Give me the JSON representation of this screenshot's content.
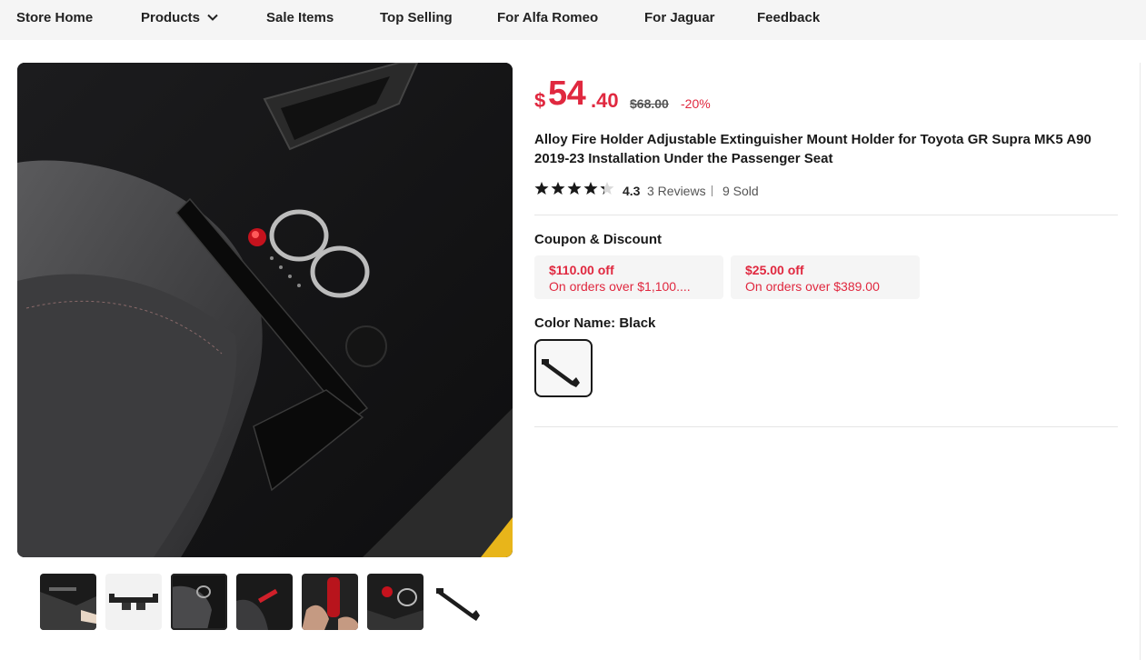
{
  "nav": {
    "items": [
      "Store Home",
      "Products",
      "Sale Items",
      "Top Selling",
      "For Alfa Romeo",
      "For Jaguar",
      "Feedback"
    ]
  },
  "product": {
    "price": {
      "currency": "$",
      "integer": "54",
      "decimal": ".40",
      "original": "$68.00",
      "discount": "-20%"
    },
    "title": "Alloy Fire Holder Adjustable Extinguisher Mount Holder for Toyota GR Supra MK5 A90 2019-23 Installation Under the Passenger Seat",
    "rating": {
      "stars_value": 4.3,
      "value": "4.3",
      "reviews": "3 Reviews",
      "sold": "9 Sold"
    },
    "coupons": {
      "label": "Coupon & Discount",
      "items": [
        {
          "amount": "$110.00 off",
          "condition": "On orders over $1,100...."
        },
        {
          "amount": "$25.00 off",
          "condition": "On orders over $389.00"
        }
      ]
    },
    "color": {
      "label": "Color Name: Black",
      "selected": "Black"
    }
  },
  "theme": {
    "accent": "#e0283f",
    "nav_bg": "#f5f5f5",
    "text": "#191919"
  },
  "icons": {
    "nav_dropdown": "chevron-down-icon",
    "rating": "star-icon"
  }
}
